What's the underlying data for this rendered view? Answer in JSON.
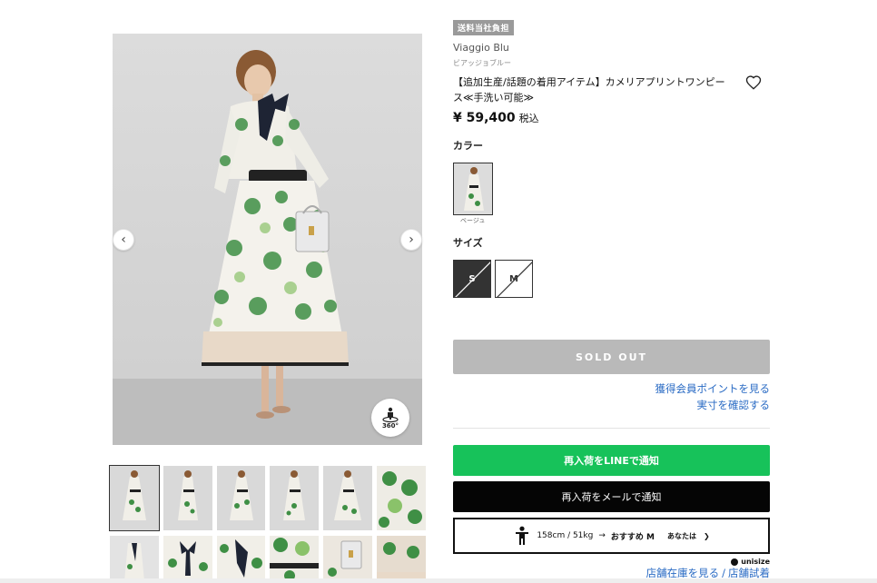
{
  "product": {
    "badge": "送料当社負担",
    "brand": "Viaggio Blu",
    "brand_kana": "ビアッジョブルー",
    "title": "【追加生産/話題の着用アイテム】カメリアプリントワンピース≪手洗い可能≫",
    "price": "¥ 59,400",
    "tax_label": "税込"
  },
  "color": {
    "label": "カラー",
    "options": [
      {
        "name": "ベージュ",
        "selected": true
      }
    ]
  },
  "size": {
    "label": "サイズ",
    "options": [
      {
        "name": "S",
        "sold_out": true,
        "selected": true
      },
      {
        "name": "M",
        "sold_out": true,
        "selected": false
      }
    ]
  },
  "actions": {
    "sold_out": "SOLD OUT",
    "points_link": "獲得会員ポイントを見る",
    "size_link": "実寸を確認する",
    "line_notify": "再入荷をLINEで通知",
    "mail_notify": "再入荷をメールで通知",
    "unisize": {
      "body": "158cm / 51kg",
      "arrow": "→",
      "recommend": "おすすめ M",
      "you": "あなたは",
      "you_chevron": "❯"
    },
    "unisize_brand": "unisize",
    "store_stock": "店舗在庫を見る",
    "store_sep": "/",
    "store_try": "店舗試着"
  },
  "gallery": {
    "view360_label": "360°",
    "prev_icon": "‹",
    "next_icon": "›",
    "thumb_count_row1": 6,
    "thumb_count_row2": 6
  },
  "colors": {
    "line_green": "#17c25a",
    "link_blue": "#2a6bc4",
    "sold_out_gray": "#b9b9b9"
  }
}
